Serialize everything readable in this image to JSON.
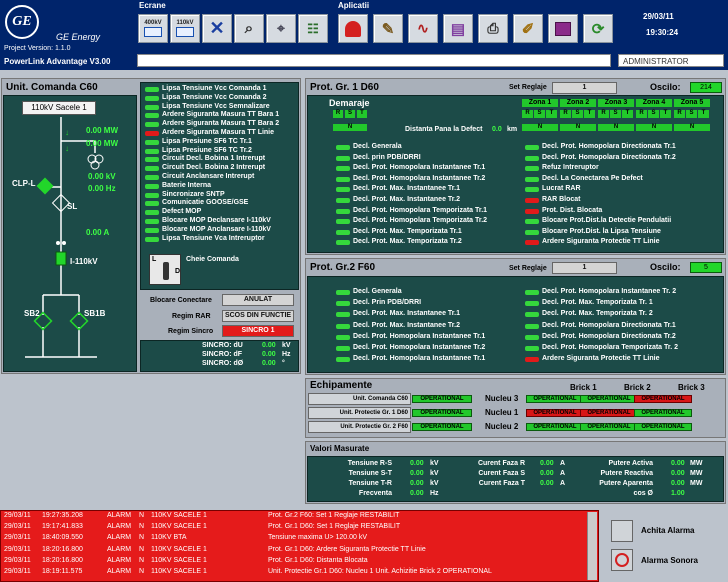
{
  "header": {
    "brand": "GE Energy",
    "version": "Project Version: 1.1.0",
    "product": "PowerLink  Advantage V3.00",
    "ecrane": "Ecrane",
    "aplicatii": "Aplicatii",
    "date": "29/03/11",
    "time": "19:30:24",
    "user": "ADMINISTRATOR",
    "tb400": "400kV",
    "tb110": "110kV"
  },
  "left": {
    "title": "Unit. Comanda C60",
    "badge": "110kV Sacele 1",
    "mw1": "0.00 MW",
    "mw2": "0.00 MW",
    "kv": "0.00 kV",
    "hz": "0.00 Hz",
    "a": "0.00 A",
    "clp": "CLP-L",
    "sl": "SL",
    "i110": "I-110kV",
    "sb2": "SB2",
    "sb1b": "SB1B",
    "alarms": [
      {
        "t": "Lipsa Tensiune Vcc Comanda 1",
        "s": "g"
      },
      {
        "t": "Lipsa Tensiune Vcc Comanda 2",
        "s": "g"
      },
      {
        "t": "Lipsa Tensiune Vcc Semnalizare",
        "s": "g"
      },
      {
        "t": "Ardere Siguranta Masura TT Bara 1",
        "s": "g"
      },
      {
        "t": "Ardere Siguranta Masura TT Bara 2",
        "s": "g"
      },
      {
        "t": "Ardere Siguranta Masura TT Linie",
        "s": "r"
      },
      {
        "t": "Lipsa Presiune SF6 TC Tr.1",
        "s": "g"
      },
      {
        "t": "Lipsa Presiune SF6 TC Tr.2",
        "s": "g"
      },
      {
        "t": "Circuit Decl. Bobina 1 Intrerupt",
        "s": "g"
      },
      {
        "t": "Circuit Decl. Bobina 2 Intrerupt",
        "s": "g"
      },
      {
        "t": "Circuit Anclansare Intrerupt",
        "s": "g"
      },
      {
        "t": "Baterie Interna",
        "s": "g"
      },
      {
        "t": "Sincronizare SNTP",
        "s": "g"
      },
      {
        "t": "Comunicatie GOOSE/GSE",
        "s": "g"
      },
      {
        "t": "Defect MOP",
        "s": "g"
      },
      {
        "t": "Blocare MOP Declansare I-110kV",
        "s": "g"
      },
      {
        "t": "Blocare MOP Anclansare I-110kV",
        "s": "g"
      },
      {
        "t": "Lipsa Tensiune Vca Intreruptor",
        "s": "g"
      }
    ],
    "key_label": "Cheie Comanda",
    "key_l": "L",
    "key_d": "D",
    "blocare_label": "Blocare Conectare",
    "blocare_val": "ANULAT",
    "rar_label": "Regim RAR",
    "rar_val": "SCOS DIN FUNCTIE",
    "sincro_label": "Regim Sincro",
    "sincro_val": "SINCRO 1",
    "sync": [
      {
        "l": "SINCRO: dU",
        "v": "0.00",
        "u": "kV"
      },
      {
        "l": "SINCRO: dF",
        "v": "0.00",
        "u": "Hz"
      },
      {
        "l": "SINCRO: dØ",
        "v": "0.00",
        "u": "°"
      }
    ]
  },
  "d60": {
    "title": "Prot. Gr. 1 D60",
    "set_label": "Set Reglaje",
    "set_val": "1",
    "oscilo_label": "Oscilo:",
    "oscilo_val": "214",
    "demaraje": "Demaraje",
    "zones": [
      "Zona 1",
      "Zona 2",
      "Zona 3",
      "Zona 4",
      "Zona 5"
    ],
    "rst": [
      "R",
      "S",
      "T"
    ],
    "n": "N",
    "dist_label": "Distanta Pana la Defect",
    "dist_val": "0.0",
    "dist_unit": "km",
    "col1": [
      {
        "t": "Decl. Generala",
        "s": "g"
      },
      {
        "t": "Decl. prin PDB/DRRI",
        "s": "g"
      },
      {
        "t": "Decl. Prot. Homopolara Instantanee Tr.1",
        "s": "g"
      },
      {
        "t": "Decl. Prot. Homopolara Instantanee Tr.2",
        "s": "g"
      },
      {
        "t": "Decl. Prot. Max. Instantanee Tr.1",
        "s": "g"
      },
      {
        "t": "Decl. Prot. Max. Instantanee Tr.2",
        "s": "g"
      },
      {
        "t": "Decl. Prot. Homopolara Temporizata Tr.1",
        "s": "g"
      },
      {
        "t": "Decl. Prot. Homopolara Temporizata Tr.2",
        "s": "g"
      },
      {
        "t": "Decl. Prot. Max. Temporizata Tr.1",
        "s": "g"
      },
      {
        "t": "Decl. Prot. Max. Temporizata Tr.2",
        "s": "g"
      }
    ],
    "col2": [
      {
        "t": "Decl. Prot. Homopolara Directionata Tr.1",
        "s": "g"
      },
      {
        "t": "Decl. Prot. Homopolara Directionata Tr.2",
        "s": "g"
      },
      {
        "t": "Refuz Intreruptor",
        "s": "g"
      },
      {
        "t": "Decl. La Conectarea Pe Defect",
        "s": "g"
      },
      {
        "t": "Lucrat RAR",
        "s": "g"
      },
      {
        "t": "RAR Blocat",
        "s": "r"
      },
      {
        "t": "Prot. Dist. Blocata",
        "s": "r"
      },
      {
        "t": "Blocare Prot.Dist.la Detectie Pendulatii",
        "s": "g"
      },
      {
        "t": "Blocare Prot.Dist. la Lipsa Tensiune",
        "s": "g"
      },
      {
        "t": "Ardere Siguranta Protectie TT Linie",
        "s": "r"
      }
    ]
  },
  "f60": {
    "title": "Prot. Gr.2 F60",
    "set_label": "Set Reglaje",
    "set_val": "1",
    "oscilo_label": "Oscilo:",
    "oscilo_val": "5",
    "col1": [
      {
        "t": "Decl. Generala",
        "s": "g"
      },
      {
        "t": "Decl. Prin PDB/DRRI",
        "s": "g"
      },
      {
        "t": "Decl. Prot. Max. Instantanee Tr.1",
        "s": "g"
      },
      {
        "t": "Decl. Prot. Max. Instantanee Tr.2",
        "s": "g"
      },
      {
        "t": "Decl. Prot. Homopolara Instantanee Tr.1",
        "s": "g"
      },
      {
        "t": "Decl. Prot. Homopolara Instantanee Tr.2",
        "s": "g"
      },
      {
        "t": "Decl. Prot. Homopolara Instantanee Tr.1",
        "s": "g"
      }
    ],
    "col2": [
      {
        "t": "Decl. Prot. Homopolara Instantanee Tr. 2",
        "s": "g"
      },
      {
        "t": "Decl. Prot. Max. Temporizata Tr. 1",
        "s": "g"
      },
      {
        "t": "Decl. Prot. Max. Temporizata Tr. 2",
        "s": "g"
      },
      {
        "t": "Decl. Prot. Homopolara Directionata Tr.1",
        "s": "g"
      },
      {
        "t": "Decl. Prot. Homopolara Directionata Tr.2",
        "s": "g"
      },
      {
        "t": "Decl. Prot. Homopolara Temporizata Tr. 2",
        "s": "g"
      },
      {
        "t": "Ardere Siguranta Protectie TT Linie",
        "s": "r"
      }
    ]
  },
  "echip": {
    "title": "Echipamente",
    "bricks": [
      "Brick 1",
      "Brick 2",
      "Brick 3"
    ],
    "rows": [
      {
        "unit": "Unit. Comanda C60",
        "unit_state": "OPERATIONAL",
        "nucleu": "Nucleu 3",
        "b": [
          {
            "t": "OPERATIONAL",
            "s": "g"
          },
          {
            "t": "OPERATIONAL",
            "s": "g"
          },
          {
            "t": "OPERATIONAL",
            "s": "r"
          }
        ]
      },
      {
        "unit": "Unit. Protectie Gr. 1 D60",
        "unit_state": "OPERATIONAL",
        "nucleu": "Nucleu 1",
        "b": [
          {
            "t": "OPERATIONAL",
            "s": "r"
          },
          {
            "t": "OPERATIONAL",
            "s": "r"
          },
          {
            "t": "OPERATIONAL",
            "s": "g"
          }
        ]
      },
      {
        "unit": "Unit. Protectie Gr. 2 F60",
        "unit_state": "OPERATIONAL",
        "nucleu": "Nucleu 2",
        "b": [
          {
            "t": "OPERATIONAL",
            "s": "g"
          },
          {
            "t": "OPERATIONAL",
            "s": "g"
          },
          {
            "t": "OPERATIONAL",
            "s": "g"
          }
        ]
      }
    ]
  },
  "valori": {
    "title": "Valori Masurate",
    "c1": [
      {
        "l": "Tensiune R-S",
        "v": "0.00",
        "u": "kV"
      },
      {
        "l": "Tensiune S-T",
        "v": "0.00",
        "u": "kV"
      },
      {
        "l": "Tensiune T-R",
        "v": "0.00",
        "u": "kV"
      },
      {
        "l": "Frecventa",
        "v": "0.00",
        "u": "Hz"
      }
    ],
    "c2": [
      {
        "l": "Curent Faza R",
        "v": "0.00",
        "u": "A"
      },
      {
        "l": "Curent Faza S",
        "v": "0.00",
        "u": "A"
      },
      {
        "l": "Curent Faza T",
        "v": "0.00",
        "u": "A"
      }
    ],
    "c3": [
      {
        "l": "Putere Activa",
        "v": "0.00",
        "u": "MW"
      },
      {
        "l": "Putere Reactiva",
        "v": "0.00",
        "u": "MW"
      },
      {
        "l": "Putere Aparenta",
        "v": "0.00",
        "u": "MW"
      },
      {
        "l": "cos Ø",
        "v": "1.00",
        "u": ""
      }
    ]
  },
  "log": [
    {
      "d": "29/03/11",
      "t": "19:27:35.208",
      "a": "ALARM",
      "n": "N",
      "u": "110KV SACELE 1",
      "m": "Prot. Gr.2 F60: Set 1 Reglaje RESTABILIT"
    },
    {
      "d": "29/03/11",
      "t": "19:17:41.833",
      "a": "ALARM",
      "n": "N",
      "u": "110KV SACELE 1",
      "m": "Prot. Gr.1 D60: Set 1 Reglaje RESTABILIT"
    },
    {
      "d": "29/03/11",
      "t": "18:40:09.550",
      "a": "ALARM",
      "n": "N",
      "u": "110KV BTA",
      "m": "Tensiune maxima U>  120.00 kV"
    },
    {
      "d": "29/03/11",
      "t": "18:20:16.800",
      "a": "ALARM",
      "n": "N",
      "u": "110KV SACELE 1",
      "m": "Prot. Gr.1 D60: Ardere Siguranta Protectie TT Linie"
    },
    {
      "d": "29/03/11",
      "t": "18:20:16.800",
      "a": "ALARM",
      "n": "N",
      "u": "110KV SACELE 1",
      "m": "Prot. Gr.1 D60: Distanta Blocata"
    },
    {
      "d": "29/03/11",
      "t": "18:19:11.575",
      "a": "ALARM",
      "n": "N",
      "u": "110KV SACELE 1",
      "m": "Unit. Protectie Gr.1 D60: Nucleu 1 Unit. Achizitie Brick 2 OPERATIONAL"
    }
  ],
  "ack_label": "Achita Alarma",
  "sound_label": "Alarma Sonora"
}
